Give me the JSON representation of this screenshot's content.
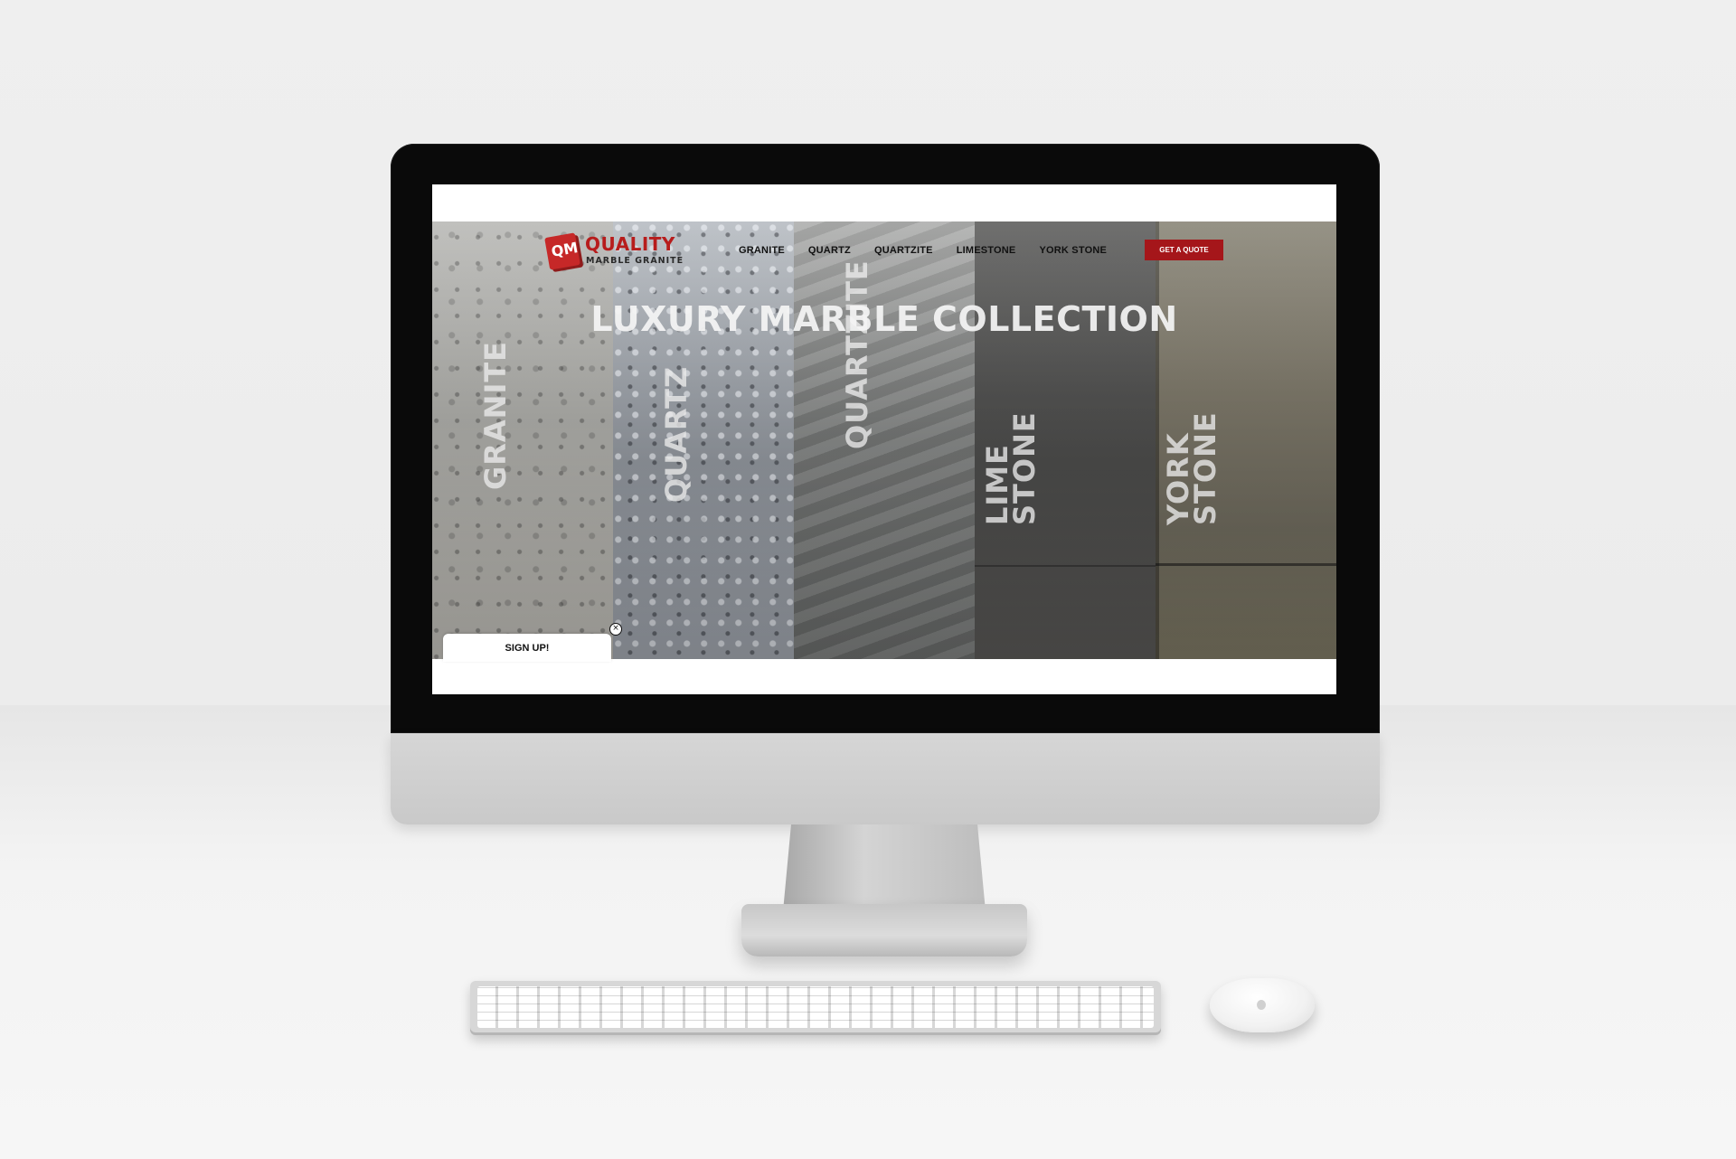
{
  "site": {
    "logo": {
      "mark": "QM",
      "title": "QUALITY",
      "subtitle": "MARBLE GRANITE"
    },
    "nav": [
      "GRANITE",
      "QUARTZ",
      "QUARTZITE",
      "LIMESTONE",
      "YORK STONE"
    ],
    "cta": "GET A QUOTE",
    "hero_title": "LUXURY MARBLE COLLECTION",
    "panels": [
      {
        "label": "GRANITE"
      },
      {
        "label": "QUARTZ"
      },
      {
        "label": "QUARTZITE"
      },
      {
        "label": "LIME\nSTONE"
      },
      {
        "label": "YORK\nSTONE"
      }
    ],
    "signup": {
      "label": "SIGN UP!",
      "close": "×"
    }
  },
  "colors": {
    "brand_red": "#a5161a",
    "logo_red": "#b71c1c"
  },
  "icons": {
    "close": "close-icon",
    "logo": "qm-logo-icon"
  }
}
